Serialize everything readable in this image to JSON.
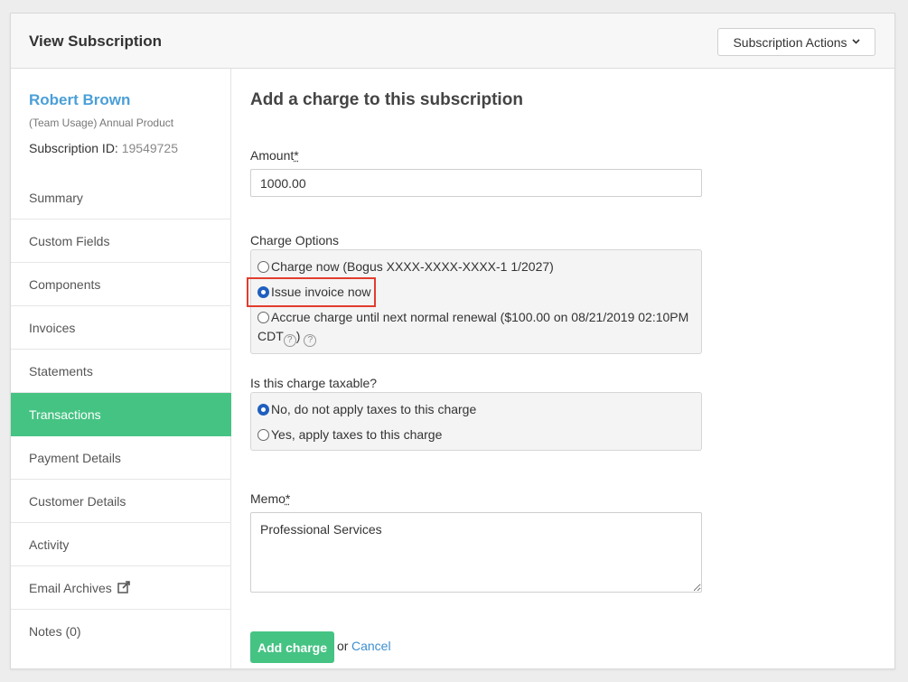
{
  "header": {
    "title": "View Subscription",
    "actions_label": "Subscription Actions"
  },
  "sidebar": {
    "customer_name": "Robert Brown",
    "product": "(Team Usage) Annual Product",
    "subscription_id_label": "Subscription ID:",
    "subscription_id": "19549725",
    "items": [
      {
        "label": "Summary"
      },
      {
        "label": "Custom Fields"
      },
      {
        "label": "Components"
      },
      {
        "label": "Invoices"
      },
      {
        "label": "Statements"
      },
      {
        "label": "Transactions"
      },
      {
        "label": "Payment Details"
      },
      {
        "label": "Customer Details"
      },
      {
        "label": "Activity"
      },
      {
        "label": "Email Archives"
      },
      {
        "label": "Notes (0)"
      }
    ],
    "active_item": "Transactions"
  },
  "form": {
    "title": "Add a charge to this subscription",
    "amount_label": "Amount",
    "required_marker": "*",
    "amount_value": "1000.00",
    "charge_options_label": "Charge Options",
    "charge_options": [
      {
        "label": "Charge now (Bogus XXXX-XXXX-XXXX-1 1/2027)",
        "checked": false
      },
      {
        "label": "Issue invoice now",
        "checked": true
      },
      {
        "label": "Accrue charge until next normal renewal ($100.00 on 08/21/2019 02:10PM",
        "label_line2": "CDT",
        "checked": false
      }
    ],
    "help_glyph": "?",
    "close_paren": ")",
    "taxable_label": "Is this charge taxable?",
    "tax_options": [
      {
        "label": "No, do not apply taxes to this charge",
        "checked": true
      },
      {
        "label": "Yes, apply taxes to this charge",
        "checked": false
      }
    ],
    "memo_label": "Memo",
    "memo_value": "Professional Services",
    "submit_label": "Add charge",
    "or_text": "or",
    "cancel_label": "Cancel"
  },
  "colors": {
    "accent_green": "#45c383",
    "link_blue": "#4a9fd8",
    "highlight_red": "#e23c2e",
    "radio_checked": "#1f5fbf"
  },
  "icons": {
    "actions_chevron": "chevron-down-icon",
    "email_archives": "external-link-icon",
    "help": "help-circle-icon"
  }
}
